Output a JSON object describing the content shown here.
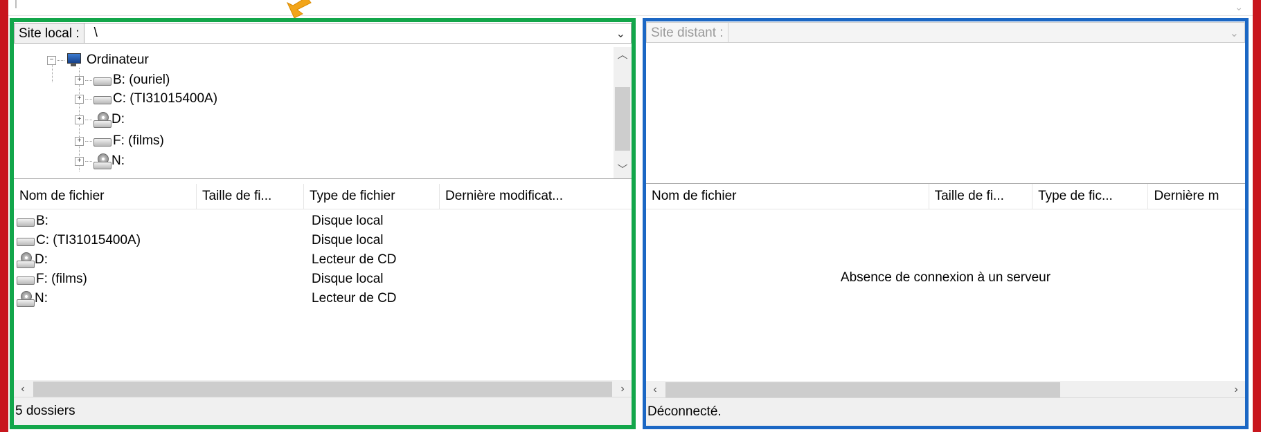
{
  "local_panel": {
    "site_label": "Site local :",
    "site_path": "\\",
    "tree": {
      "root": "Ordinateur",
      "items": [
        {
          "label": "B: (ouriel)",
          "icon": "hard-drive-icon"
        },
        {
          "label": "C: (TI31015400A)",
          "icon": "hard-drive-icon"
        },
        {
          "label": "D:",
          "icon": "cd-drive-icon"
        },
        {
          "label": "F: (films)",
          "icon": "hard-drive-icon"
        },
        {
          "label": "N:",
          "icon": "cd-drive-icon"
        }
      ]
    },
    "columns": [
      "Nom de fichier",
      "Taille de fi...",
      "Type de fichier",
      "Dernière modificat..."
    ],
    "rows": [
      {
        "name": "B:",
        "type": "Disque local",
        "icon": "hard-drive-icon"
      },
      {
        "name": "C: (TI31015400A)",
        "type": "Disque local",
        "icon": "hard-drive-icon"
      },
      {
        "name": "D:",
        "type": "Lecteur de CD",
        "icon": "cd-drive-icon"
      },
      {
        "name": "F: (films)",
        "type": "Disque local",
        "icon": "hard-drive-icon"
      },
      {
        "name": "N:",
        "type": "Lecteur de CD",
        "icon": "cd-drive-icon"
      }
    ],
    "status": "5 dossiers"
  },
  "remote_panel": {
    "site_label": "Site distant :",
    "site_path": "",
    "columns": [
      "Nom de fichier",
      "Taille de fi...",
      "Type de fic...",
      "Dernière m"
    ],
    "empty_message": "Absence de connexion à un serveur",
    "status": "Déconnecté."
  },
  "colors": {
    "outer_highlight": "#c8161d",
    "local_highlight": "#12a64a",
    "remote_highlight": "#1b67c4",
    "arrow": "#f2a51a"
  }
}
